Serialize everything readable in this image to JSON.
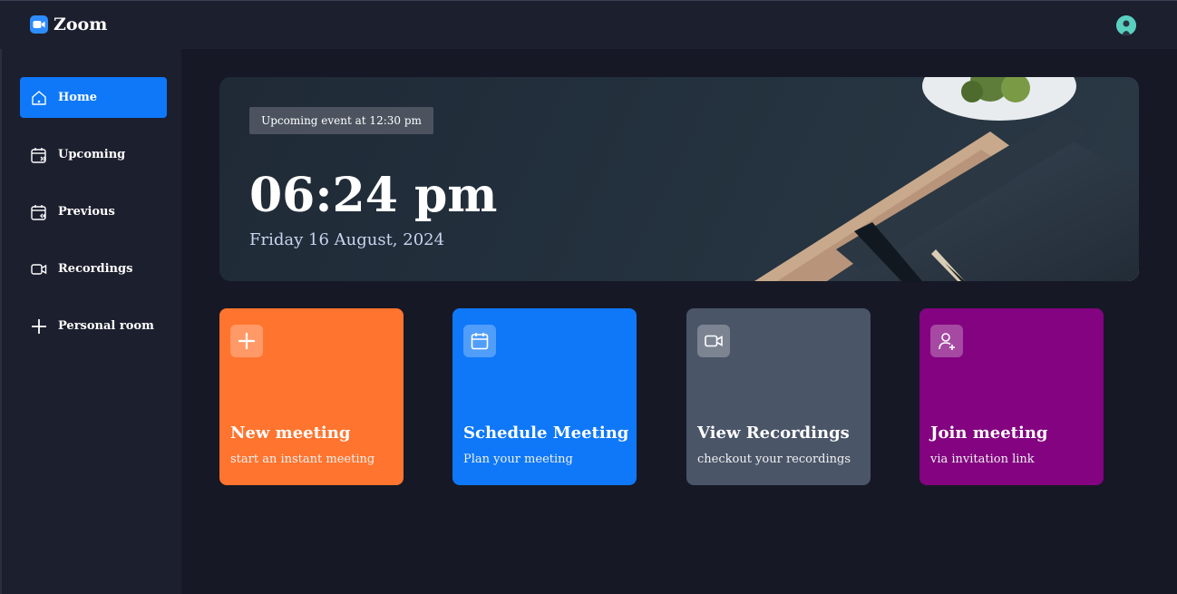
{
  "header": {
    "app_name": "Zoom",
    "logo_icon": "video-camera-logo-icon",
    "avatar_icon": "user-avatar-icon"
  },
  "sidebar": {
    "items": [
      {
        "label": "Home",
        "icon": "home-icon",
        "active": true
      },
      {
        "label": "Upcoming",
        "icon": "calendar-upcoming-icon",
        "active": false
      },
      {
        "label": "Previous",
        "icon": "calendar-previous-icon",
        "active": false
      },
      {
        "label": "Recordings",
        "icon": "video-icon",
        "active": false
      },
      {
        "label": "Personal room",
        "icon": "plus-icon",
        "active": false
      }
    ]
  },
  "hero": {
    "event_badge": "Upcoming event at 12:30 pm",
    "time": "06:24 pm",
    "date": "Friday 16 August, 2024"
  },
  "cards": [
    {
      "title": "New meeting",
      "subtitle": "start an instant meeting",
      "icon": "plus-icon",
      "color": "#ff742e"
    },
    {
      "title": "Schedule Meeting",
      "subtitle": "Plan your meeting",
      "icon": "calendar-icon",
      "color": "#0e78f9"
    },
    {
      "title": "View Recordings",
      "subtitle": "checkout your recordings",
      "icon": "video-icon",
      "color": "#4a5568"
    },
    {
      "title": "Join meeting",
      "subtitle": "via invitation link",
      "icon": "add-user-icon",
      "color": "#830380"
    }
  ],
  "colors": {
    "accent": "#0e78f9",
    "sidebar_bg": "#1c1f2e",
    "main_bg": "#161925"
  }
}
